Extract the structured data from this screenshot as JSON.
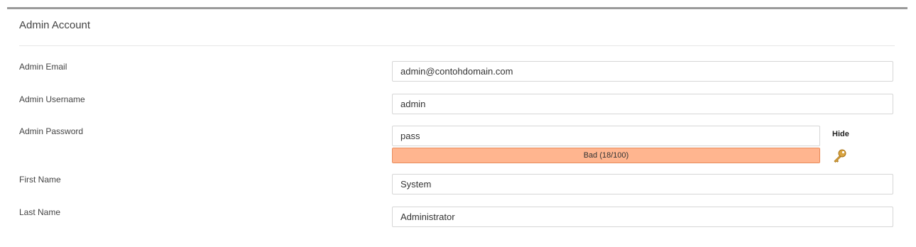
{
  "section": {
    "title": "Admin Account"
  },
  "fields": {
    "email": {
      "label": "Admin Email",
      "value": "admin@contohdomain.com"
    },
    "username": {
      "label": "Admin Username",
      "value": "admin"
    },
    "password": {
      "label": "Admin Password",
      "value": "pass"
    },
    "first_name": {
      "label": "First Name",
      "value": "System"
    },
    "last_name": {
      "label": "Last Name",
      "value": "Administrator"
    }
  },
  "password_strength": {
    "text": "Bad (18/100)",
    "score": 18,
    "max": 100,
    "color": "#ffb58f",
    "border_color": "#e88a5a"
  },
  "password_toggle": {
    "label": "Hide",
    "icon": "key-icon"
  }
}
